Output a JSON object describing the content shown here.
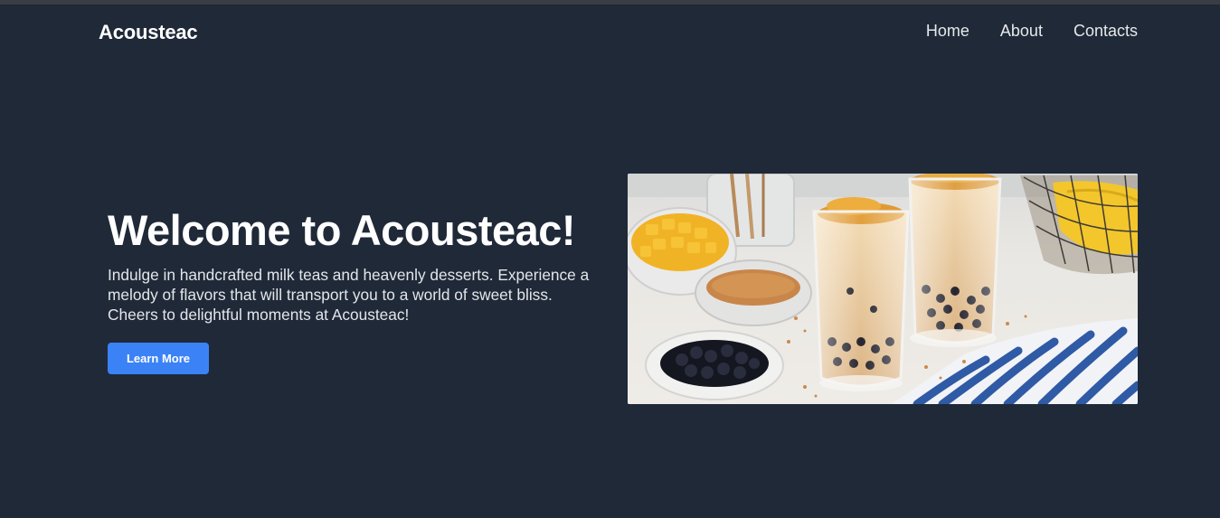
{
  "brand": {
    "name": "Acousteac"
  },
  "nav": {
    "links": [
      {
        "label": "Home"
      },
      {
        "label": "About"
      },
      {
        "label": "Contacts"
      }
    ]
  },
  "hero": {
    "title": "Welcome to Acousteac!",
    "description": "Indulge in handcrafted milk teas and heavenly desserts. Experience a melody of flavors that will transport you to a world of sweet bliss. Cheers to delightful moments at Acousteac!",
    "button_label": "Learn More",
    "image_alt": "Bubble milk tea with mango, brown sugar and tapioca pearls"
  },
  "colors": {
    "background": "#1f2938",
    "accent": "#3b82f6",
    "text": "#ffffff"
  }
}
